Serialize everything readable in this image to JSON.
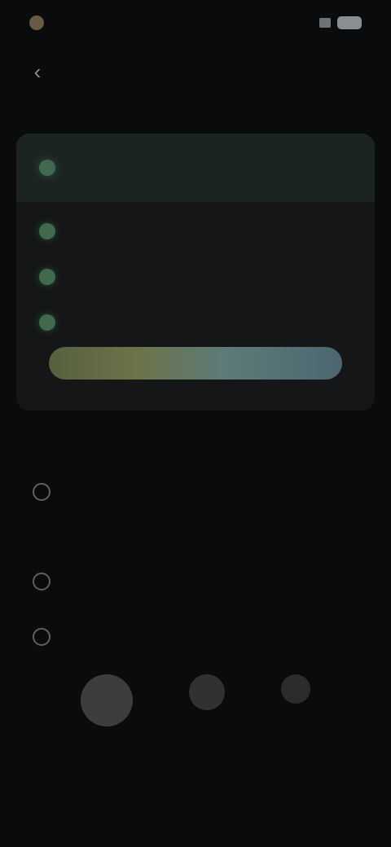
{
  "status_bar": {
    "time": "",
    "battery": ""
  },
  "app_bar": {
    "title": "",
    "back_icon": "arrow-left-icon"
  },
  "plan": {
    "heading": "",
    "subheading": "",
    "items": [
      {
        "label": "",
        "sub": ""
      },
      {
        "label": ""
      },
      {
        "label": ""
      },
      {
        "label": ""
      }
    ],
    "upgrade_label": "",
    "accent": "#4e8c63"
  },
  "account": {
    "label": "",
    "row_label": "",
    "row_value": ""
  },
  "appearance": {
    "label": "",
    "row1_label": "",
    "row1_value": "",
    "row2_label": "",
    "row2_sub": ""
  },
  "colors": {
    "background": "#0a0b0c",
    "card": "#141617",
    "accent_green": "#4e8c63"
  }
}
